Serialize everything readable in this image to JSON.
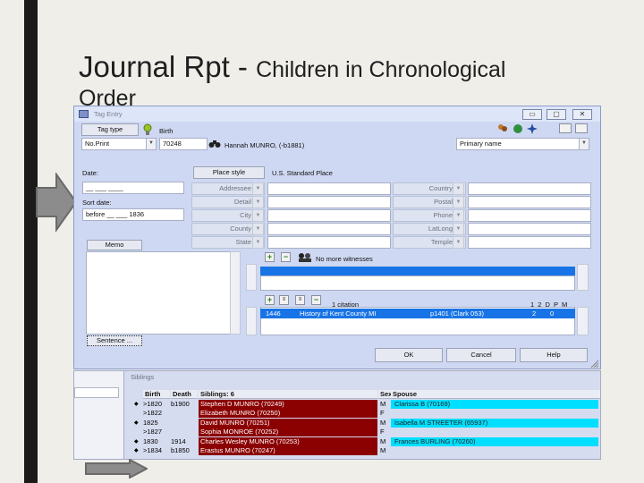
{
  "slide": {
    "title_main": "Journal Rpt - ",
    "title_sub": "Children in Chronological",
    "title_line2": "Order"
  },
  "window": {
    "title": "Tag Entry",
    "controls": [
      "▭",
      "▢",
      "✕"
    ],
    "tag_type_btn": "Tag type",
    "tag_name": "Birth",
    "print_select": "No.Print",
    "person_id": "70248",
    "person_name": "Hannah MUNRO, (-b1881)",
    "role_select": "Primary name",
    "date_label": "Date:",
    "date_value": "__ ___ ____",
    "sort_label": "Sort date:",
    "sort_value": "before __ ___ 1836",
    "memo_btn": "Memo",
    "sentence_btn": "Sentence ...",
    "place_style_btn": "Place style",
    "place_style_value": "U.S. Standard Place",
    "place_fields_left": [
      "Addressee",
      "Detail",
      "City",
      "County",
      "State"
    ],
    "place_fields_right": [
      "Country",
      "Postal",
      "Phone",
      "LatLong",
      "Temple"
    ],
    "witness_text": "No more witnesses",
    "citation_count": "1  citation",
    "citation_cols": "1 2 D P M",
    "citation": {
      "id": "1446",
      "title": "History of Kent County MI",
      "page": "p1401 (Clark 053)",
      "v1": "2",
      "v2": "0"
    },
    "ok_btn": "OK",
    "cancel_btn": "Cancel",
    "help_btn": "Help"
  },
  "siblings": {
    "pane_title": "Siblings",
    "columns": {
      "birth": "Birth",
      "death": "Death",
      "siblings": "Siblings: 6",
      "sex": "Sex",
      "spouse": "Spouse"
    },
    "rows": [
      {
        "birth": ">1820",
        "death": "b1900",
        "name": "Stephen D MUNRO (70249)",
        "sex": "M",
        "spouse": "Clarissa B (70169)",
        "marker": "◆"
      },
      {
        "birth": ">1822",
        "death": "",
        "name": "Elizabeth MUNRO (70250)",
        "sex": "F",
        "spouse": "",
        "marker": ""
      },
      {
        "birth": "1825",
        "death": "",
        "name": "David MUNRO (70251)",
        "sex": "M",
        "spouse": "Isabella M STREETER (65937)",
        "marker": "◆"
      },
      {
        "birth": ">1827",
        "death": "",
        "name": "Sophia MONROE (70252)",
        "sex": "F",
        "spouse": "",
        "marker": ""
      },
      {
        "birth": "1830",
        "death": "1914",
        "name": "Charles Wesley MUNRO (70253)",
        "sex": "M",
        "spouse": "Frances BURLING (70260)",
        "marker": "◆"
      },
      {
        "birth": ">1834",
        "death": "b1850",
        "name": "Erastus MUNRO (70247)",
        "sex": "M",
        "spouse": "",
        "marker": "◆"
      }
    ]
  }
}
